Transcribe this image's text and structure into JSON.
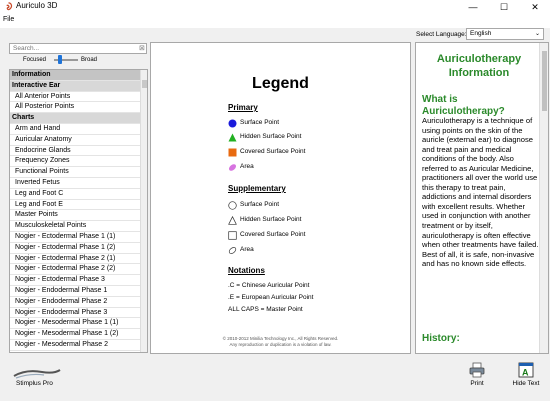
{
  "window": {
    "title": "Auriculo 3D",
    "minimize": "—",
    "maximize": "☐",
    "close": "✕"
  },
  "menu": {
    "file": "File"
  },
  "search": {
    "placeholder": "Search..."
  },
  "scope": {
    "focused": "Focused",
    "broad": "Broad"
  },
  "list": {
    "items": [
      {
        "label": "Information",
        "header": true,
        "selected": true
      },
      {
        "label": "Interactive Ear",
        "header": true
      },
      {
        "label": "All Anterior Points"
      },
      {
        "label": "All Posterior Points"
      },
      {
        "label": "Charts",
        "header": true
      },
      {
        "label": "Arm and Hand"
      },
      {
        "label": "Auricular Anatomy"
      },
      {
        "label": "Endocrine Glands"
      },
      {
        "label": "Frequency Zones"
      },
      {
        "label": "Functional Points"
      },
      {
        "label": "Inverted Fetus"
      },
      {
        "label": "Leg and Foot C"
      },
      {
        "label": "Leg and Foot E"
      },
      {
        "label": "Master Points"
      },
      {
        "label": "Musculoskeletal Points"
      },
      {
        "label": "Nogier - Ectodermal Phase 1 (1)"
      },
      {
        "label": "Nogier - Ectodermal Phase 1 (2)"
      },
      {
        "label": "Nogier - Ectodermal Phase 2 (1)"
      },
      {
        "label": "Nogier - Ectodermal Phase 2 (2)"
      },
      {
        "label": "Nogier - Ectodermal Phase 3"
      },
      {
        "label": "Nogier - Endodermal Phase 1"
      },
      {
        "label": "Nogier - Endodermal Phase 2"
      },
      {
        "label": "Nogier - Endodermal Phase 3"
      },
      {
        "label": "Nogier - Mesodermal Phase 1 (1)"
      },
      {
        "label": "Nogier - Mesodermal Phase 1 (2)"
      },
      {
        "label": "Nogier - Mesodermal Phase 2"
      }
    ]
  },
  "legend": {
    "title": "Legend",
    "primary": {
      "heading": "Primary",
      "items": [
        {
          "label": "Surface Point",
          "icon": "blue-circle-icon",
          "color": "#1a1adb"
        },
        {
          "label": "Hidden Surface Point",
          "icon": "green-triangle-icon",
          "color": "#22b022"
        },
        {
          "label": "Covered Surface Point",
          "icon": "orange-square-icon",
          "color": "#e86a10"
        },
        {
          "label": "Area",
          "icon": "pink-ellipse-icon",
          "color": "#d774e0"
        }
      ]
    },
    "supplementary": {
      "heading": "Supplementary",
      "items": [
        {
          "label": "Surface Point",
          "icon": "outline-circle-icon"
        },
        {
          "label": "Hidden Surface Point",
          "icon": "outline-triangle-icon"
        },
        {
          "label": "Covered Surface Point",
          "icon": "outline-square-icon"
        },
        {
          "label": "Area",
          "icon": "outline-ellipse-icon"
        }
      ]
    },
    "notations": {
      "heading": "Notations",
      "lines": [
        ".C = Chinese Auricular Point",
        ".E = European Auricular Point",
        "ALL CAPS = Master Point"
      ]
    },
    "copyright": [
      "© 2010-2012 Minilia Technology Inc., All Rights Reserved.",
      "Any reproduction or duplication is a violation of law."
    ]
  },
  "language": {
    "label": "Select Language:",
    "value": "English"
  },
  "info": {
    "title": "Auriculotherapy Information",
    "heading1": "What is Auriculotherapy?",
    "body": "Auriculotherapy is a technique of using points on the skin of the auricle (external ear) to diagnose and treat pain and medical conditions of the body. Also referred to as Auricular Medicine, practitioners all over the world use this therapy to treat pain, addictions and internal disorders with excellent results. Whether used in conjunction with another treatment or by itself, auriculotherapy is often effective when other treatments have failed. Best of all, it is safe, non-invasive and has no known side effects.",
    "heading2": "History:"
  },
  "footer": {
    "device": "Stimplus Pro",
    "print": "Print",
    "hide_text": "Hide Text"
  },
  "colors": {
    "accent_green": "#2b8a2b",
    "slider_blue": "#1e73d8"
  }
}
